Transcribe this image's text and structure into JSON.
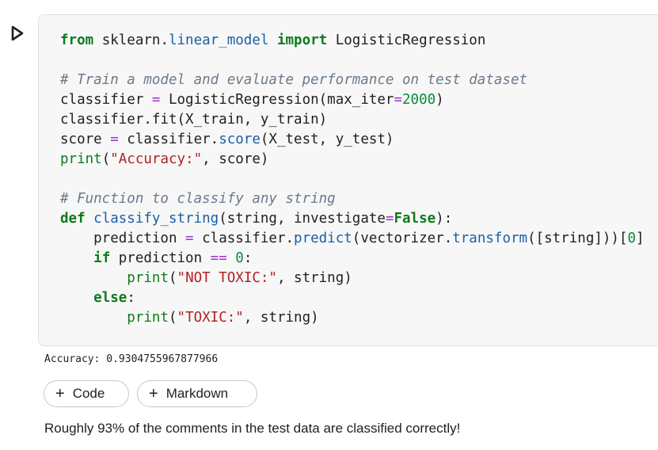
{
  "run_button": {
    "icon": "play-icon"
  },
  "code_cell": {
    "lines": [
      [
        {
          "t": "kw",
          "v": "from"
        },
        {
          "t": "pn",
          "v": " sklearn."
        },
        {
          "t": "mod",
          "v": "linear_model"
        },
        {
          "t": "pn",
          "v": " "
        },
        {
          "t": "kw",
          "v": "import"
        },
        {
          "t": "pn",
          "v": " LogisticRegression"
        }
      ],
      [],
      [
        {
          "t": "cm",
          "v": "# Train a model and evaluate performance on test dataset"
        }
      ],
      [
        {
          "t": "pn",
          "v": "classifier "
        },
        {
          "t": "op",
          "v": "="
        },
        {
          "t": "pn",
          "v": " LogisticRegression(max_iter"
        },
        {
          "t": "op",
          "v": "="
        },
        {
          "t": "num",
          "v": "2000"
        },
        {
          "t": "pn",
          "v": ")"
        }
      ],
      [
        {
          "t": "pn",
          "v": "classifier.fit(X_train, y_train)"
        }
      ],
      [
        {
          "t": "pn",
          "v": "score "
        },
        {
          "t": "op",
          "v": "="
        },
        {
          "t": "pn",
          "v": " classifier."
        },
        {
          "t": "fn",
          "v": "score"
        },
        {
          "t": "pn",
          "v": "(X_test, y_test)"
        }
      ],
      [
        {
          "t": "bi",
          "v": "print"
        },
        {
          "t": "pn",
          "v": "("
        },
        {
          "t": "str",
          "v": "\"Accuracy:\""
        },
        {
          "t": "pn",
          "v": ", score)"
        }
      ],
      [],
      [
        {
          "t": "cm",
          "v": "# Function to classify any string"
        }
      ],
      [
        {
          "t": "kw",
          "v": "def"
        },
        {
          "t": "pn",
          "v": " "
        },
        {
          "t": "fn",
          "v": "classify_string"
        },
        {
          "t": "pn",
          "v": "(string, investigate"
        },
        {
          "t": "op",
          "v": "="
        },
        {
          "t": "kw",
          "v": "False"
        },
        {
          "t": "pn",
          "v": "):"
        }
      ],
      [
        {
          "t": "pn",
          "v": "    prediction "
        },
        {
          "t": "op",
          "v": "="
        },
        {
          "t": "pn",
          "v": " classifier."
        },
        {
          "t": "fn",
          "v": "predict"
        },
        {
          "t": "pn",
          "v": "(vectorizer."
        },
        {
          "t": "fn",
          "v": "transform"
        },
        {
          "t": "pn",
          "v": "([string]))["
        },
        {
          "t": "num",
          "v": "0"
        },
        {
          "t": "pn",
          "v": "]"
        }
      ],
      [
        {
          "t": "pn",
          "v": "    "
        },
        {
          "t": "kw",
          "v": "if"
        },
        {
          "t": "pn",
          "v": " prediction "
        },
        {
          "t": "op",
          "v": "=="
        },
        {
          "t": "pn",
          "v": " "
        },
        {
          "t": "num",
          "v": "0"
        },
        {
          "t": "pn",
          "v": ":"
        }
      ],
      [
        {
          "t": "pn",
          "v": "        "
        },
        {
          "t": "bi",
          "v": "print"
        },
        {
          "t": "pn",
          "v": "("
        },
        {
          "t": "str",
          "v": "\"NOT TOXIC:\""
        },
        {
          "t": "pn",
          "v": ", string)"
        }
      ],
      [
        {
          "t": "pn",
          "v": "    "
        },
        {
          "t": "kw",
          "v": "else"
        },
        {
          "t": "pn",
          "v": ":"
        }
      ],
      [
        {
          "t": "pn",
          "v": "        "
        },
        {
          "t": "bi",
          "v": "print"
        },
        {
          "t": "pn",
          "v": "("
        },
        {
          "t": "str",
          "v": "\"TOXIC:\""
        },
        {
          "t": "pn",
          "v": ", string)"
        }
      ]
    ]
  },
  "output": {
    "text": "Accuracy: 0.9304755967877966"
  },
  "toolbar": {
    "add_code_label": "Code",
    "add_markdown_label": "Markdown",
    "plus_glyph": "+"
  },
  "text_cell": {
    "text": "Roughly 93% of the comments in the test data are classified correctly!"
  },
  "colors": {
    "keyword": "#0d7a1e",
    "string": "#b22222",
    "number": "#0b8a3a",
    "function": "#1a5fa8",
    "comment": "#6b7a8a",
    "operator": "#a230c9",
    "cell_background": "#f7f7f7"
  }
}
